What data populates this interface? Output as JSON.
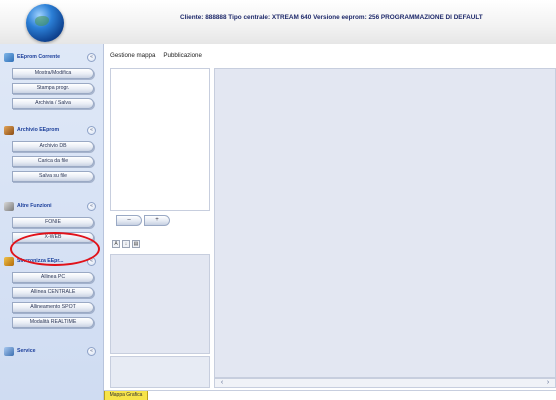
{
  "header": {
    "title": "Cliente: 888888 Tipo centrale: XTREAM 640 Versione eeprom: 256  PROGRAMMAZIONE DI DEFAULT"
  },
  "sidebar": {
    "sections": [
      {
        "title": "EEprom Corrente",
        "icon": "eeprom-wave-icon",
        "items": [
          "Mostra/Modifica",
          "Stampa progr.",
          "Archivia / Salva"
        ]
      },
      {
        "title": "Archivio EEprom",
        "icon": "archive-icon",
        "items": [
          "Archivio DB",
          "Carica da file",
          "Salva su file"
        ]
      },
      {
        "title": "Altre Funzioni",
        "icon": "speaker-icon",
        "items": [
          "FONIE",
          "X-WEB"
        ]
      },
      {
        "title": "Sincronizza EEpr...",
        "icon": "sync-icon",
        "items": [
          "Allinea PC",
          "Allinea CENTRALE",
          "Allineamento SPOT",
          "Modalità REALTIME"
        ]
      },
      {
        "title": "Service",
        "icon": "service-icon",
        "items": []
      }
    ],
    "toggle_glyph": "«"
  },
  "menu": {
    "items": [
      "Gestione mappa",
      "Pubblicazione"
    ]
  },
  "panel": {
    "nav_prev": "–",
    "nav_next": "+",
    "tool_sort_az": "A",
    "tool_sort_za": "↓",
    "tool_props": "▤"
  },
  "scroll": {
    "left_arrow": "‹",
    "right_arrow": "›"
  },
  "tabs": {
    "active": "Mappa Grafica"
  },
  "colors": {
    "accent_title": "#1c3f9b",
    "highlight_ring": "#e1121a",
    "tab_active": "#f7e44a"
  }
}
